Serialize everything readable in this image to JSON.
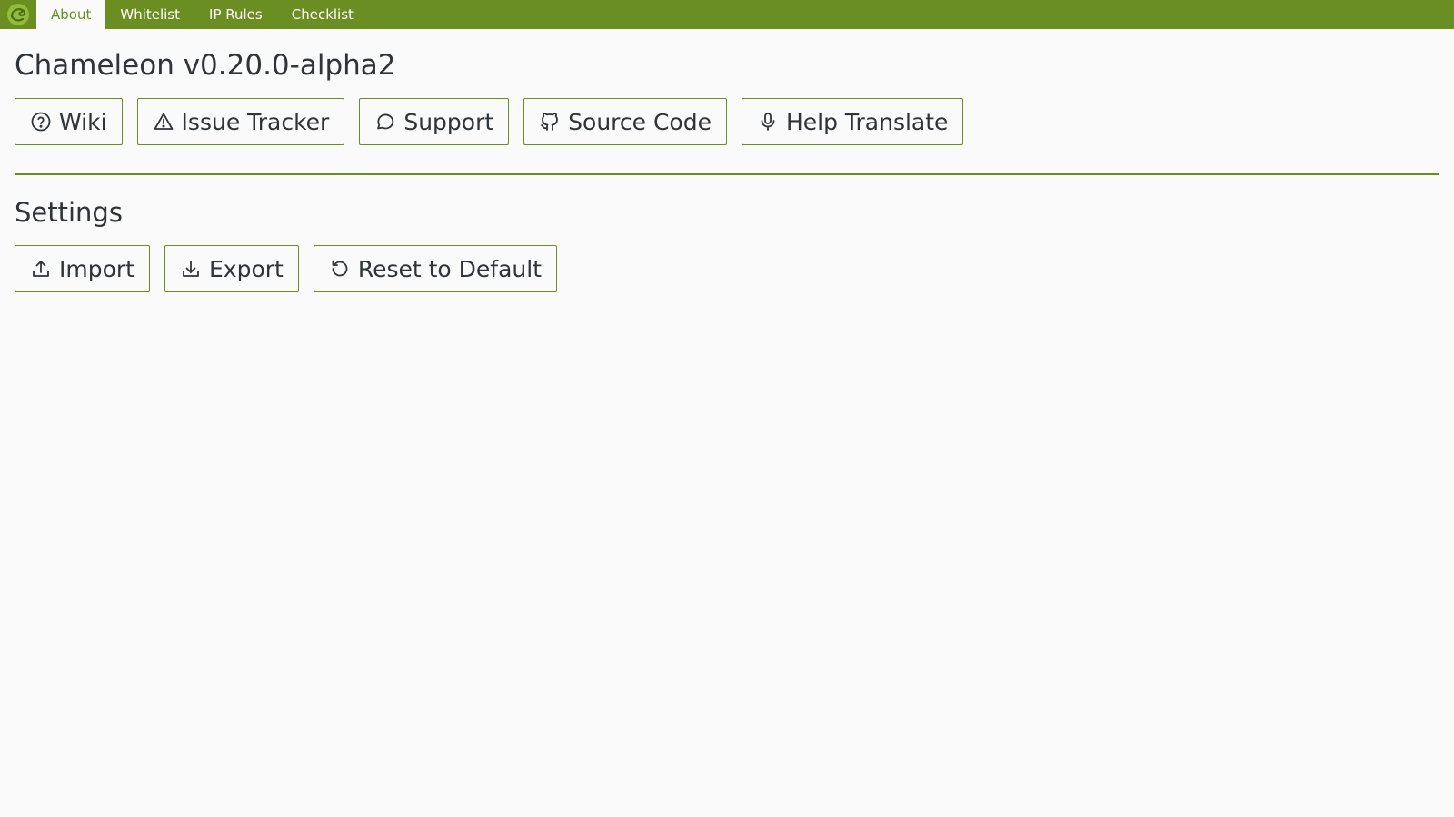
{
  "nav": {
    "tabs": [
      {
        "label": "About",
        "active": true
      },
      {
        "label": "Whitelist",
        "active": false
      },
      {
        "label": "IP Rules",
        "active": false
      },
      {
        "label": "Checklist",
        "active": false
      }
    ]
  },
  "about": {
    "title": "Chameleon v0.20.0-alpha2",
    "links": [
      {
        "label": "Wiki",
        "icon": "help-circle-icon"
      },
      {
        "label": "Issue Tracker",
        "icon": "alert-triangle-icon"
      },
      {
        "label": "Support",
        "icon": "chat-bubble-icon"
      },
      {
        "label": "Source Code",
        "icon": "github-icon"
      },
      {
        "label": "Help Translate",
        "icon": "microphone-icon"
      }
    ]
  },
  "settings": {
    "title": "Settings",
    "buttons": [
      {
        "label": "Import",
        "icon": "upload-icon"
      },
      {
        "label": "Export",
        "icon": "download-icon"
      },
      {
        "label": "Reset to Default",
        "icon": "reset-icon"
      }
    ]
  },
  "colors": {
    "accent": "#6b8e23",
    "background": "#fafafa",
    "text": "#2f3438"
  }
}
